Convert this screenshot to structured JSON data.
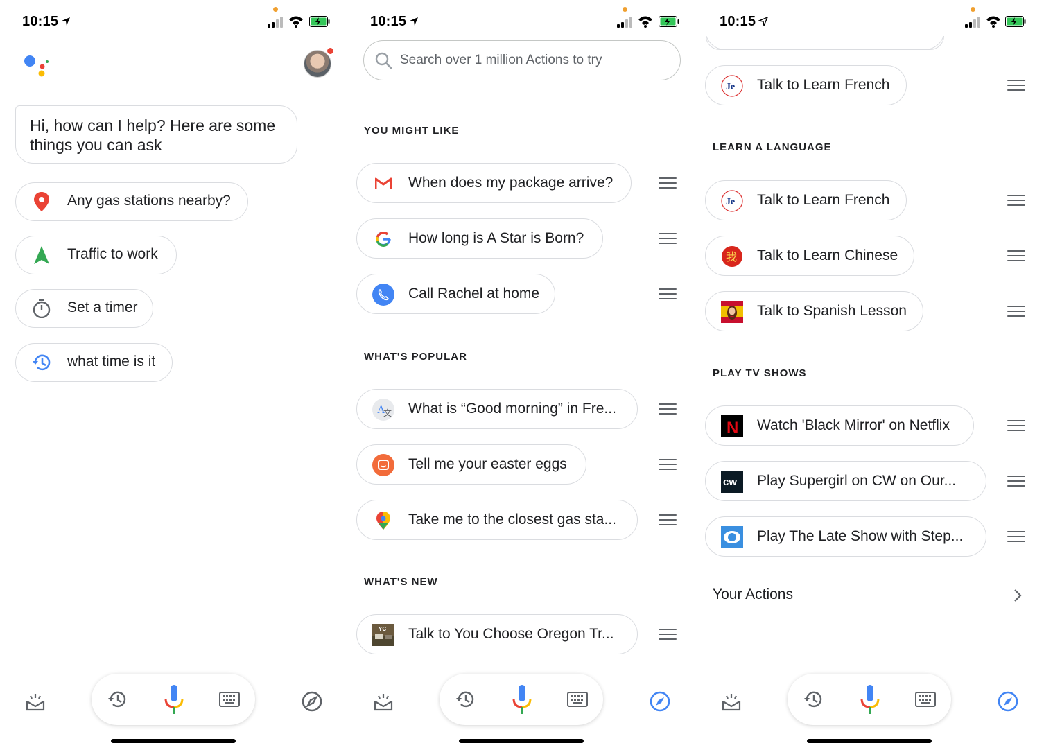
{
  "status": {
    "time": "10:15"
  },
  "phone1": {
    "greeting": "Hi, how can I help? Here are some things you can ask",
    "suggestions": [
      {
        "label": "Any gas stations nearby?",
        "icon": "location-pin-icon"
      },
      {
        "label": "Traffic to work",
        "icon": "navigation-arrow-icon"
      },
      {
        "label": "Set a timer",
        "icon": "timer-icon"
      },
      {
        "label": "what time is it",
        "icon": "history-icon"
      }
    ]
  },
  "phone2": {
    "search_placeholder": "Search over 1 million Actions to try",
    "sections": [
      {
        "title": "YOU MIGHT LIKE",
        "items": [
          {
            "label": "When does my package arrive?",
            "icon": "gmail-icon"
          },
          {
            "label": "How long is A Star is Born?",
            "icon": "google-icon"
          },
          {
            "label": "Call Rachel at home",
            "icon": "phone-icon"
          }
        ]
      },
      {
        "title": "WHAT'S POPULAR",
        "items": [
          {
            "label": "What is “Good morning” in Fre...",
            "icon": "translate-icon"
          },
          {
            "label": "Tell me your easter eggs",
            "icon": "easter-egg-icon"
          },
          {
            "label": "Take me to the closest gas sta...",
            "icon": "maps-icon"
          }
        ]
      },
      {
        "title": "WHAT'S NEW",
        "items": [
          {
            "label": "Talk to You Choose Oregon Tr...",
            "icon": "oregon-trail-icon"
          }
        ]
      }
    ]
  },
  "phone3": {
    "top_item": {
      "label": "Talk to Learn French",
      "icon": "learn-french-icon"
    },
    "sections": [
      {
        "title": "LEARN A LANGUAGE",
        "items": [
          {
            "label": "Talk to Learn French",
            "icon": "learn-french-icon"
          },
          {
            "label": "Talk to Learn Chinese",
            "icon": "learn-chinese-icon"
          },
          {
            "label": "Talk to Spanish Lesson",
            "icon": "spanish-lesson-icon"
          }
        ]
      },
      {
        "title": "PLAY TV SHOWS",
        "items": [
          {
            "label": "Watch 'Black Mirror' on Netflix",
            "icon": "netflix-icon"
          },
          {
            "label": "Play Supergirl on CW on Our...",
            "icon": "cw-icon"
          },
          {
            "label": "Play The Late Show with Step...",
            "icon": "cbs-icon"
          }
        ]
      }
    ],
    "your_actions": "Your Actions"
  },
  "icons": {
    "french_glyph": "Je",
    "chinese_glyph": "我",
    "netflix_glyph": "N",
    "cw_glyph": "cw",
    "oregon_glyph": "YC"
  },
  "colors": {
    "blue": "#4285f4",
    "red": "#ea4335",
    "yellow": "#fbbc04",
    "green": "#34a853",
    "chip_border": "#dadce0"
  }
}
